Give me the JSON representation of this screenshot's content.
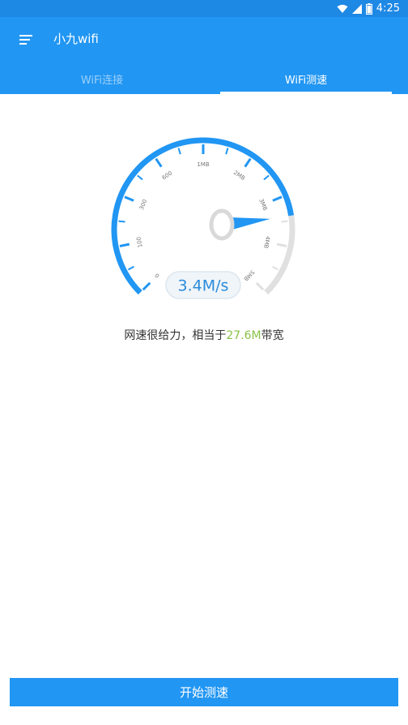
{
  "status_bar": {
    "time": "4:25",
    "icons": [
      "wifi-icon",
      "signal-icon",
      "battery-icon"
    ]
  },
  "app": {
    "title": "小九wifi",
    "menu_icon": "menu-icon"
  },
  "tabs": [
    {
      "label": "WiFi连接",
      "active": false
    },
    {
      "label": "WiFi测速",
      "active": true
    }
  ],
  "gauge": {
    "ticks": [
      "0",
      "100",
      "300",
      "600",
      "1MB",
      "2MB",
      "3MB",
      "4MB",
      "5MB"
    ],
    "speed_display": "3.4M/s",
    "current_value": 3.4,
    "max_label": "5MB",
    "accent_color": "#2196f3",
    "track_color": "#e0e0e0"
  },
  "result": {
    "prefix": "网速很给力，相当于",
    "bandwidth": "27.6M",
    "suffix": "带宽",
    "highlight_color": "#8bc34a"
  },
  "action": {
    "start_label": "开始测速"
  },
  "colors": {
    "primary": "#2196f3",
    "status_bar": "#1e88e5"
  }
}
